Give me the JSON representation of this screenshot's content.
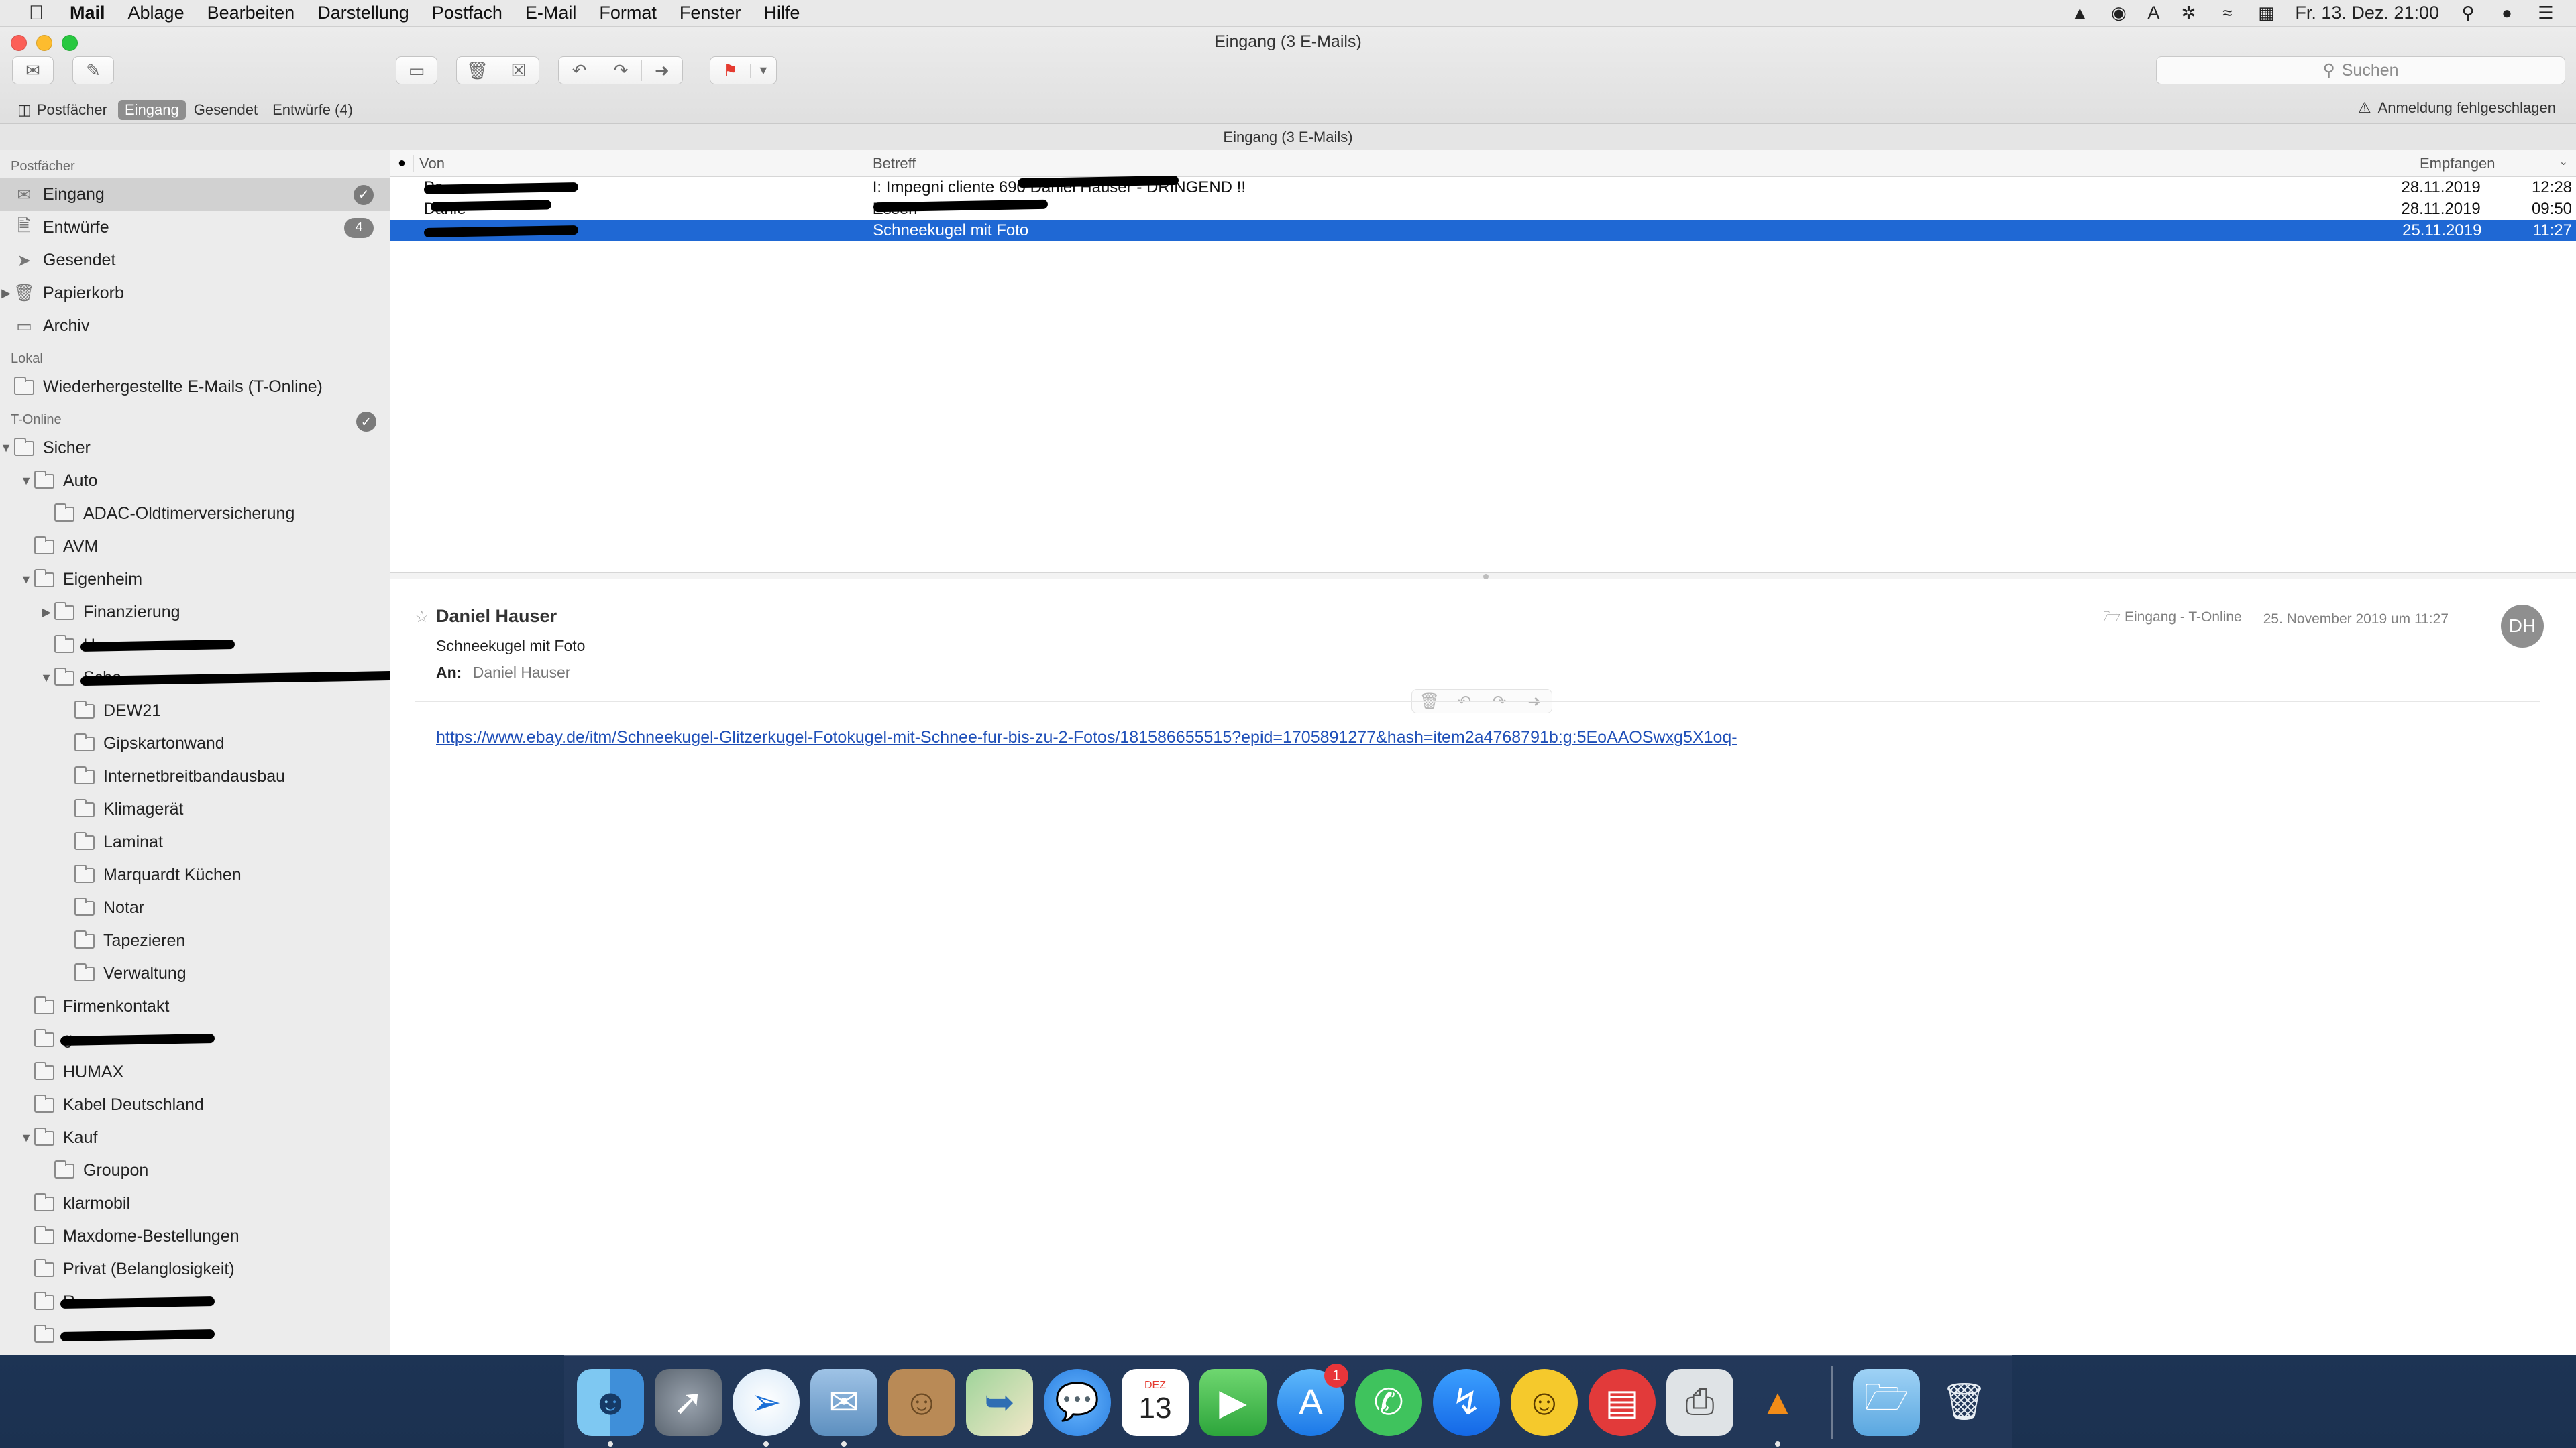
{
  "menubar": {
    "app": "Mail",
    "items": [
      "Ablage",
      "Bearbeiten",
      "Darstellung",
      "Postfach",
      "E-Mail",
      "Format",
      "Fenster",
      "Hilfe"
    ],
    "input_indicator": "A",
    "datetime": "Fr. 13. Dez.  21:00"
  },
  "window": {
    "title": "Eingang (3 E-Mails)",
    "search_placeholder": "Suchen",
    "favorites": {
      "mailboxes": "Postfächer",
      "inbox": "Eingang",
      "sent": "Gesendet",
      "drafts": "Entwürfe (4)"
    },
    "login_warning": "Anmeldung fehlgeschlagen",
    "column_title": "Eingang (3 E-Mails)"
  },
  "sidebar": {
    "section_mailboxes": "Postfächer",
    "mailboxes": [
      {
        "label": "Eingang"
      },
      {
        "label": "Entwürfe",
        "badge": "4"
      },
      {
        "label": "Gesendet"
      },
      {
        "label": "Papierkorb"
      },
      {
        "label": "Archiv"
      }
    ],
    "section_local": "Lokal",
    "local": [
      {
        "label": "Wiederhergestellte E-Mails (T-Online)"
      }
    ],
    "section_account": "T-Online",
    "account": [
      {
        "label": "Sicher"
      },
      {
        "label": "Auto"
      },
      {
        "label": "ADAC-Oldtimerversicherung"
      },
      {
        "label": "AVM"
      },
      {
        "label": "Eigenheim"
      },
      {
        "label": "Finanzierung"
      },
      {
        "label": "H"
      },
      {
        "label": "Scho"
      },
      {
        "label": "DEW21"
      },
      {
        "label": "Gipskartonwand"
      },
      {
        "label": "Internetbreitbandausbau"
      },
      {
        "label": "Klimagerät"
      },
      {
        "label": "Laminat"
      },
      {
        "label": "Marquardt Küchen"
      },
      {
        "label": "Notar"
      },
      {
        "label": "Tapezieren"
      },
      {
        "label": "Verwaltung"
      },
      {
        "label": "Firmenkontakt"
      },
      {
        "label": "g"
      },
      {
        "label": "HUMAX"
      },
      {
        "label": "Kabel Deutschland"
      },
      {
        "label": "Kauf"
      },
      {
        "label": "Groupon"
      },
      {
        "label": "klarmobil"
      },
      {
        "label": "Maxdome-Bestellungen"
      },
      {
        "label": "Privat (Belanglosigkeit)"
      },
      {
        "label": "R"
      },
      {
        "label": ""
      }
    ]
  },
  "message_list": {
    "columns": {
      "from": "Von",
      "subject": "Betreff",
      "received": "Empfangen"
    },
    "rows": [
      {
        "from": "Pa",
        "subject": "I: Impegni cliente 690 Daniel Hauser - DRINGEND !!",
        "date": "28.11.2019",
        "time": "12:28"
      },
      {
        "from": "Danie",
        "subject": "Essen",
        "date": "28.11.2019",
        "time": "09:50"
      },
      {
        "from": "",
        "subject": "Schneekugel mit Foto",
        "date": "25.11.2019",
        "time": "11:27"
      }
    ]
  },
  "reader": {
    "sender": "Daniel Hauser",
    "subject": "Schneekugel mit Foto",
    "to_label": "An:",
    "to_value": "Daniel Hauser",
    "mailbox": "Eingang - T-Online",
    "date": "25. November 2019 um 11:27",
    "avatar_initials": "DH",
    "link": "https://www.ebay.de/itm/Schneekugel-Glitzerkugel-Fotokugel-mit-Schnee-fur-bis-zu-2-Fotos/181586655515?epid=1705891277&hash=item2a4768791b:g:5EoAAOSwxg5X1oq-"
  },
  "dock": {
    "apps": [
      "finder-icon",
      "launchpad-icon",
      "safari-icon",
      "mail-icon",
      "contacts-icon",
      "maps-icon",
      "messages-icon",
      "calendar-icon",
      "facetime-icon",
      "app-store-icon",
      "whatsapp-icon",
      "messenger-icon",
      "emoji-app-icon",
      "radio-icon",
      "printer-icon",
      "vlc-icon",
      "folder-icon",
      "trash-icon"
    ],
    "calendar_month": "DEZ",
    "calendar_day": "13",
    "app_store_badge": "1"
  },
  "colors": {
    "selection": "#1f68d4",
    "link": "#1f4fb8",
    "sidebar_bg": "#ececec",
    "flag_red": "#e53b30"
  }
}
